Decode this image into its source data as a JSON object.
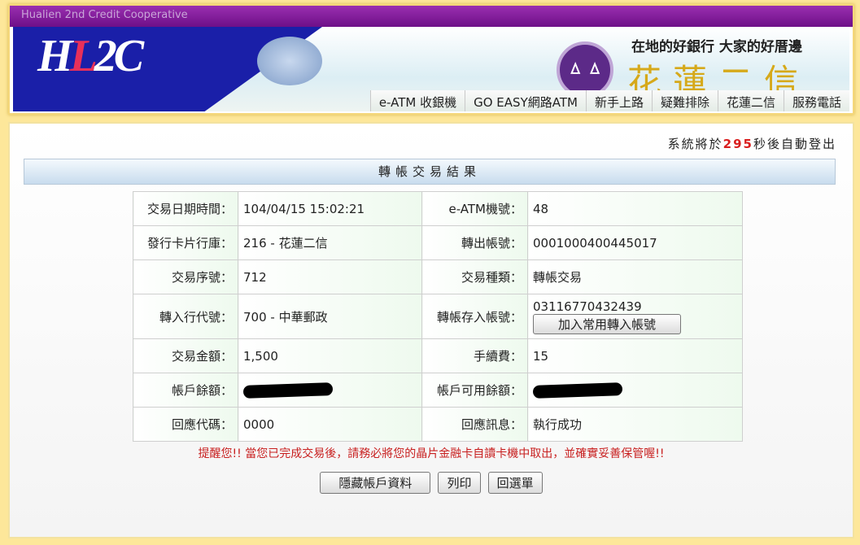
{
  "header": {
    "org_en": "Hualien 2nd Credit Cooperative",
    "logo_text": "HL2C",
    "slogan": "在地的好銀行 大家的好厝邊",
    "bank_name": "花蓮二信",
    "nav": [
      "e-ATM 收銀機",
      "GO EASY網路ATM",
      "新手上路",
      "疑難排除",
      "花蓮二信",
      "服務電話"
    ]
  },
  "logout": {
    "prefix": "系統將於",
    "seconds": "295",
    "suffix": "秒後自動登出"
  },
  "title": "轉帳交易結果",
  "rows": [
    {
      "l1": "交易日期時間：",
      "v1": "104/04/15 15:02:21",
      "l2": "e-ATM機號：",
      "v2": "48"
    },
    {
      "l1": "發行卡片行庫：",
      "v1": "216 - 花蓮二信",
      "l2": "轉出帳號：",
      "v2": "0001000400445017"
    },
    {
      "l1": "交易序號：",
      "v1": "712",
      "l2": "交易種類：",
      "v2": "轉帳交易"
    },
    {
      "l1": "轉入行代號：",
      "v1": "700 - 中華郵政",
      "l2": "轉帳存入帳號：",
      "v2": "03116770432439"
    },
    {
      "l1": "交易金額：",
      "v1": "1,500",
      "l2": "手續費：",
      "v2": "15"
    },
    {
      "l1": "帳戶餘額：",
      "v1": "",
      "l2": "帳戶可用餘額：",
      "v2": ""
    },
    {
      "l1": "回應代碼：",
      "v1": "0000",
      "l2": "回應訊息：",
      "v2": "執行成功"
    }
  ],
  "add_account_button": "加入常用轉入帳號",
  "warning": "提醒您!! 當您已完成交易後，請務必將您的晶片金融卡自讀卡機中取出，並確實妥善保管喔!!",
  "buttons": {
    "hide": "隱藏帳戶資料",
    "print": "列印",
    "menu": "回選單"
  }
}
